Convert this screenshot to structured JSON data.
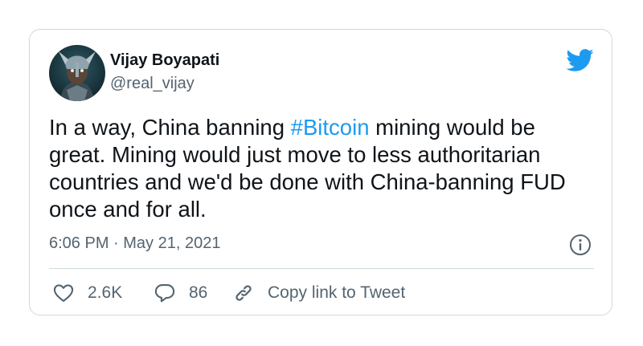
{
  "tweet": {
    "author": {
      "name": "Vijay Boyapati",
      "handle": "@real_vijay"
    },
    "text": {
      "before_hashtag": "In a way, China banning ",
      "hashtag": "#Bitcoin",
      "after_hashtag": " mining would be great. Mining would just move to less authoritarian countries and we'd be done with China-banning FUD once and for all."
    },
    "timestamp": "6:06 PM · May 21, 2021",
    "actions": {
      "likes": "2.6K",
      "replies": "86",
      "copy_link": "Copy link to Tweet"
    }
  },
  "colors": {
    "accent": "#1d9bf0",
    "text": "#0f1419",
    "secondary": "#536471",
    "border": "#cfd9de"
  },
  "icons": {
    "brand": "twitter-bird-icon",
    "info": "info-icon",
    "like": "heart-icon",
    "reply": "speech-bubble-icon",
    "link": "link-icon"
  }
}
